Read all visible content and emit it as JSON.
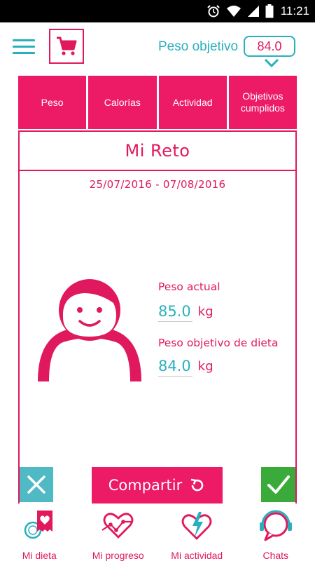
{
  "status_bar": {
    "time": "11:21",
    "icons": [
      "alarm-icon",
      "wifi-icon",
      "signal-icon",
      "battery-icon"
    ]
  },
  "header": {
    "target_label": "Peso objetivo",
    "target_value": "84.0"
  },
  "tabs": [
    {
      "label": "Peso"
    },
    {
      "label": "Calorías"
    },
    {
      "label": "Actividad"
    },
    {
      "label": "Objetivos cumplidos"
    }
  ],
  "card": {
    "title": "Mi Reto",
    "date_range": "25/07/2016 - 07/08/2016",
    "current_weight_label": "Peso actual",
    "current_weight_value": "85.0",
    "current_weight_unit": "kg",
    "diet_target_label": "Peso objetivo de dieta",
    "diet_target_value": "84.0",
    "diet_target_unit": "kg"
  },
  "actions": {
    "share_label": "Compartir"
  },
  "bottom_nav": [
    {
      "label": "Mi dieta",
      "icon": "diet-icon"
    },
    {
      "label": "Mi progreso",
      "icon": "progress-icon"
    },
    {
      "label": "Mi actividad",
      "icon": "activity-icon"
    },
    {
      "label": "Chats",
      "icon": "chat-icon"
    }
  ],
  "colors": {
    "primary": "#e0185e",
    "accent": "#2ab0bd",
    "confirm": "#3aab3a",
    "cancel": "#4fbac4"
  }
}
